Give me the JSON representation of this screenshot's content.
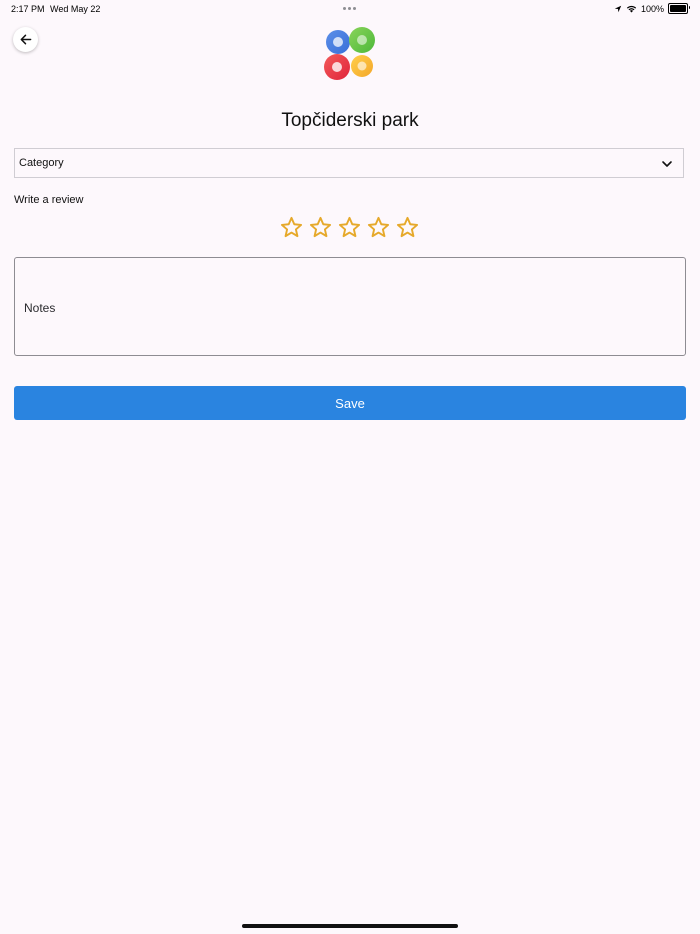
{
  "status_bar": {
    "time": "2:17 PM",
    "date": "Wed May 22",
    "battery": "100%",
    "battery_level": 1.0
  },
  "header": {
    "back_icon": "arrow-left-icon",
    "logo_icon": "four-petal-logo-icon"
  },
  "place": {
    "title": "Topčiderski park"
  },
  "category": {
    "label": "Category",
    "icon": "chevron-down-icon"
  },
  "review": {
    "label": "Write a review",
    "rating": 0,
    "max_rating": 5,
    "star_color": "#e6a92b"
  },
  "notes": {
    "placeholder": "Notes",
    "value": ""
  },
  "save": {
    "label": "Save",
    "color": "#2a84e0"
  },
  "colors": {
    "background": "#fdf8fc",
    "accent": "#2a84e0",
    "star": "#e6a92b"
  }
}
